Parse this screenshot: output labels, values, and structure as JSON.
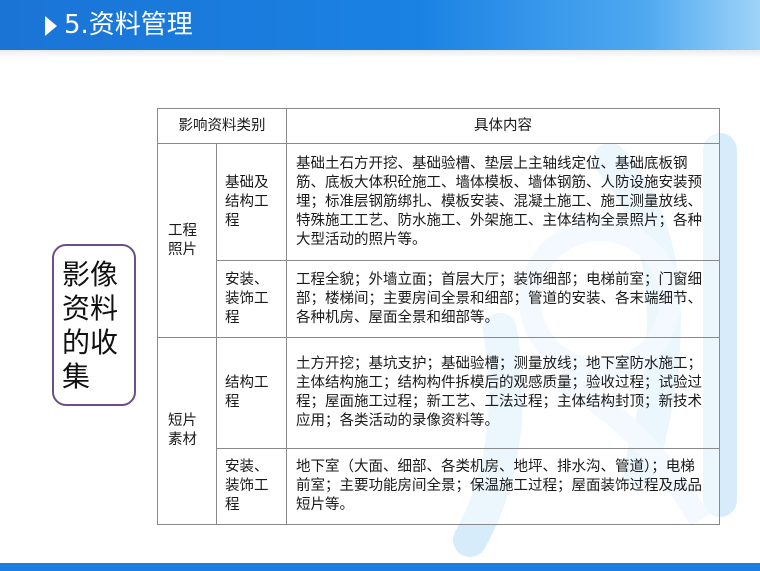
{
  "header": {
    "title": "5.资料管理"
  },
  "side_label": {
    "lines": [
      "影像",
      "资料",
      "的收",
      "集"
    ]
  },
  "table": {
    "col_category": "影响资料类别",
    "col_content": "具体内容",
    "groups": [
      {
        "name_lines": [
          "工程",
          "照片"
        ],
        "rows": [
          {
            "sub_lines": [
              "基础及",
              "结构工",
              "程"
            ],
            "content": "基础土石方开挖、基础验槽、垫层上主轴线定位、基础底板钢筋、底板大体积砼施工、墙体模板、墙体钢筋、人防设施安装预埋；标准层钢筋绑扎、模板安装、混凝土施工、施工测量放线、特殊施工工艺、防水施工、外架施工、主体结构全景照片；各种大型活动的照片等。"
          },
          {
            "sub_lines": [
              "安装、",
              "装饰工",
              "程"
            ],
            "content": "工程全貌；外墙立面；首层大厅；装饰细部；电梯前室；门窗细部；楼梯间；主要房间全景和细部；管道的安装、各末端细节、各种机房、屋面全景和细部等。"
          }
        ]
      },
      {
        "name_lines": [
          "短片",
          "素材"
        ],
        "rows": [
          {
            "sub_lines": [
              "结构工",
              "程"
            ],
            "content": "土方开挖；基坑支护；基础验槽；测量放线；地下室防水施工；主体结构施工；结构构件拆模后的观感质量；验收过程；试验过程；屋面施工过程；新工艺、工法过程；主体结构封顶；新技术应用；各类活动的录像资料等。"
          },
          {
            "sub_lines": [
              "安装、",
              "装饰工",
              "程"
            ],
            "content": "地下室（大面、细部、各类机房、地坪、排水沟、管道）；电梯前室；主要功能房间全景；保温施工过程；屋面装饰过程及成品短片等。"
          }
        ]
      }
    ]
  },
  "colors": {
    "header_blue": "#1a7fe0",
    "side_border": "#6a4f8a",
    "watermark": "#cfe9fb"
  }
}
